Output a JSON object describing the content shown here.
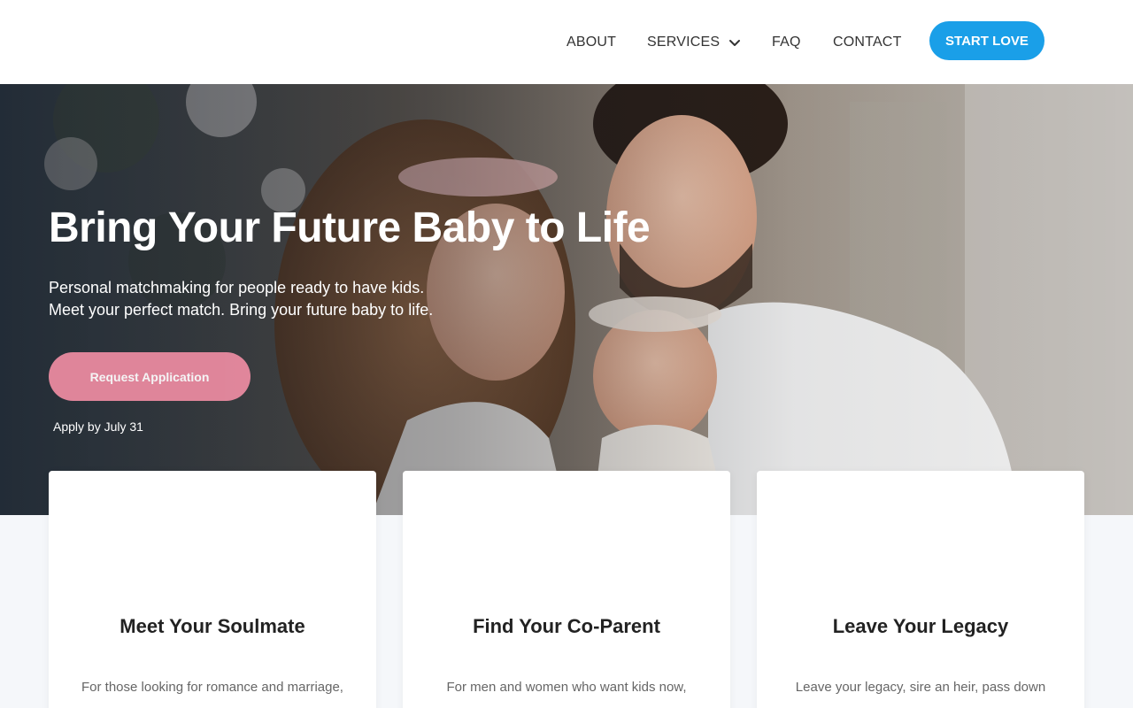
{
  "nav": {
    "about": "ABOUT",
    "services": "SERVICES",
    "faq": "FAQ",
    "contact": "CONTACT",
    "cta": "START LOVE"
  },
  "hero": {
    "title": "Bring Your Future Baby to Life",
    "subtitle_line1": "Personal matchmaking for people ready to have kids.",
    "subtitle_line2": "Meet your perfect match. Bring your future baby to life.",
    "button": "Request Application",
    "note": "Apply by July 31",
    "image_icon": "family-photo"
  },
  "cards": [
    {
      "title": "Meet Your Soulmate",
      "text": "For those looking for romance and marriage,"
    },
    {
      "title": "Find Your Co-Parent",
      "text": "For men and women who want kids now,"
    },
    {
      "title": "Leave Your Legacy",
      "text": "Leave your legacy, sire an heir, pass down"
    }
  ],
  "colors": {
    "accent_blue": "#1a9fe8",
    "accent_pink": "#e98aa0"
  }
}
